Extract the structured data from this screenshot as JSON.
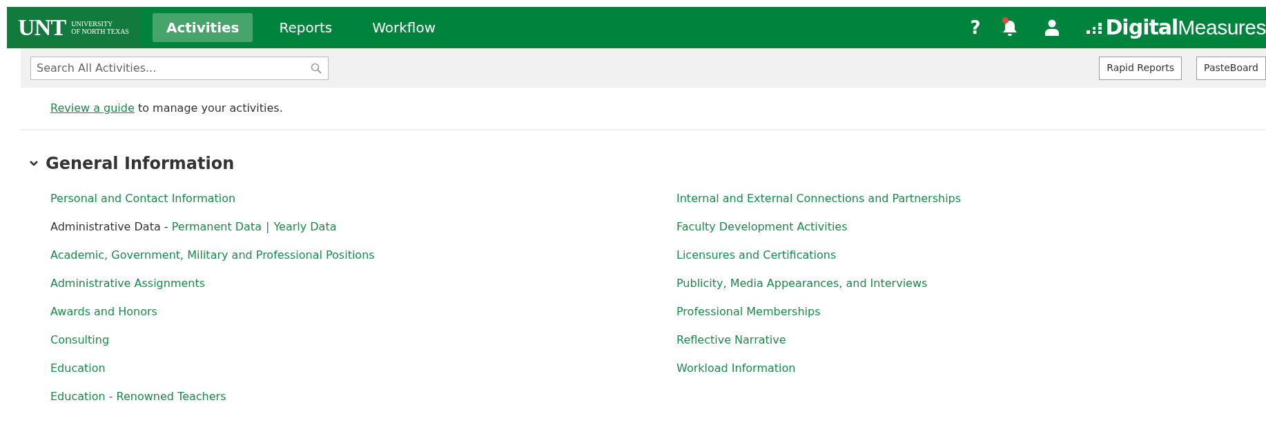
{
  "header": {
    "logo": {
      "mark": "UNT",
      "line1": "UNIVERSITY",
      "line2": "OF NORTH TEXAS"
    },
    "tabs": [
      {
        "label": "Activities",
        "selected": true
      },
      {
        "label": "Reports",
        "selected": false
      },
      {
        "label": "Workflow",
        "selected": false
      }
    ],
    "help": "?",
    "notifications": {
      "unread": true
    },
    "brand": {
      "bold": "Digital",
      "light": "Measures"
    }
  },
  "toolbar": {
    "search": {
      "placeholder": "Search All Activities..."
    },
    "buttons": [
      "Rapid Reports",
      "PasteBoard"
    ]
  },
  "intro": {
    "link": "Review a guide",
    "text": " to manage your activities."
  },
  "section": {
    "title": "General Information",
    "expanded": true,
    "columns": [
      [
        {
          "kind": "link",
          "label": "Personal and Contact Information"
        },
        {
          "kind": "group",
          "label": "Administrative Data - ",
          "links": [
            "Permanent Data",
            "Yearly Data"
          ],
          "separator": "|"
        },
        {
          "kind": "link",
          "label": "Academic, Government, Military and Professional Positions"
        },
        {
          "kind": "link",
          "label": "Administrative Assignments"
        },
        {
          "kind": "link",
          "label": "Awards and Honors"
        },
        {
          "kind": "link",
          "label": "Consulting"
        },
        {
          "kind": "link",
          "label": "Education"
        },
        {
          "kind": "link",
          "label": "Education - Renowned Teachers"
        }
      ],
      [
        {
          "kind": "link",
          "label": "Internal and External Connections and Partnerships"
        },
        {
          "kind": "link",
          "label": "Faculty Development Activities"
        },
        {
          "kind": "link",
          "label": "Licensures and Certifications"
        },
        {
          "kind": "link",
          "label": "Publicity, Media Appearances, and Interviews"
        },
        {
          "kind": "link",
          "label": "Professional Memberships"
        },
        {
          "kind": "link",
          "label": "Reflective Narrative"
        },
        {
          "kind": "link",
          "label": "Workload Information"
        }
      ]
    ]
  }
}
